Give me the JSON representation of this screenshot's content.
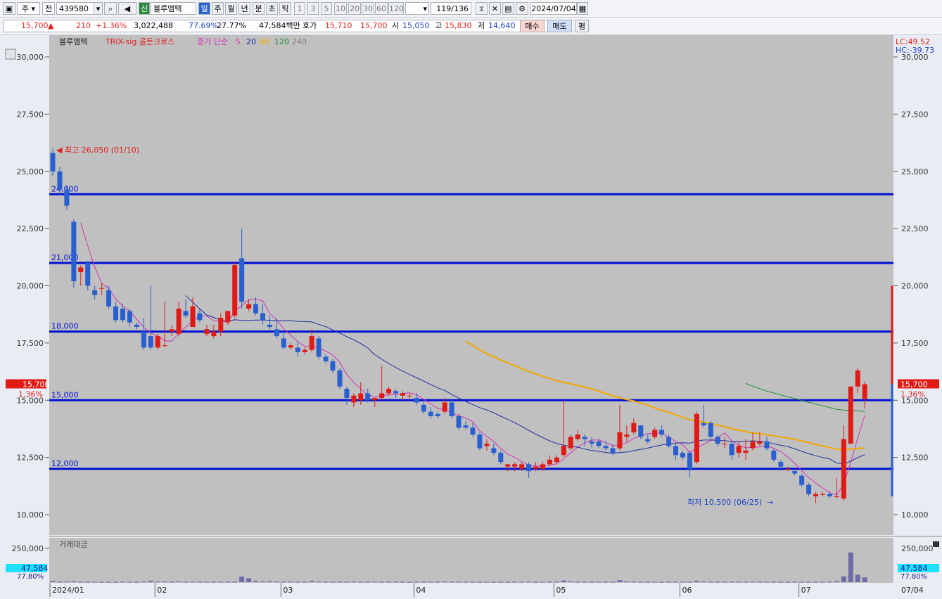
{
  "toolbar": {
    "market": "주",
    "price_type": "전",
    "code": "439580",
    "stock_badge": "신",
    "stock_name": "블루엠텍",
    "periods": [
      "일",
      "주",
      "월",
      "년",
      "분",
      "초",
      "틱"
    ],
    "minutes": [
      "1",
      "3",
      "5",
      "10",
      "20",
      "30",
      "60",
      "120"
    ],
    "count": "119",
    "count_total": "/136",
    "date": "2024/07/04"
  },
  "quote": {
    "price": "15,700",
    "change": "210",
    "change_pct": "+1.36%",
    "volume": "3,022,488",
    "ratio1": "77.69%",
    "ratio2": "27.77%",
    "amount": "47,584백만",
    "ask_label": "호가",
    "ask1": "15,710",
    "ask2": "15,700",
    "open_label": "시",
    "open": "15,050",
    "high_label": "고",
    "high": "15,830",
    "low_label": "저",
    "low": "14,640",
    "buy": "매수",
    "sell": "매도",
    "eval": "평"
  },
  "chart_data": {
    "type": "candlestick",
    "legend": {
      "name": "블루엠텍",
      "indicator": "TRIX-sig 골든크로스",
      "ma_label": "종가 단순",
      "ma_periods": [
        "5",
        "20",
        "60",
        "120",
        "240"
      ],
      "colors": {
        "5": "#d233b8",
        "20": "#1f2f9e",
        "60": "#f2a900",
        "120": "#1c8a2e",
        "240": "#808080"
      }
    },
    "y_ticks": [
      "30,000",
      "27,500",
      "25,000",
      "22,500",
      "20,000",
      "17,500",
      "15,000",
      "12,500",
      "10,000"
    ],
    "ylim": [
      9500,
      30800
    ],
    "x_labels": [
      "2024/01",
      "02",
      "03",
      "04",
      "05",
      "06",
      "07"
    ],
    "hlines": [
      {
        "label": "24,000",
        "value": 24000
      },
      {
        "label": "21,000",
        "value": 21000
      },
      {
        "label": "18,000",
        "value": 18000
      },
      {
        "label": "15,000",
        "value": 15000
      },
      {
        "label": "12,000",
        "value": 12000
      }
    ],
    "max_note": "최고 26,050 (01/10)",
    "min_note": "최저 10,500 (06/25)",
    "last_price": "15,700",
    "last_pct": "1.36%",
    "right_info": {
      "lc": "LC:49.52",
      "hc": "HC:-39.73"
    },
    "volume_title": "거래대금",
    "volume_tick": "250,000",
    "volume_last": "47,584",
    "volume_pct": "77.80%",
    "end_date": "07/04",
    "candles": [
      [
        25800,
        26000,
        24800,
        25000
      ],
      [
        25000,
        25200,
        24000,
        24200
      ],
      [
        24200,
        24400,
        23300,
        23500
      ],
      [
        22800,
        22900,
        19900,
        20200
      ],
      [
        20600,
        20900,
        20000,
        20800
      ],
      [
        21000,
        21100,
        19800,
        20000
      ],
      [
        19800,
        20000,
        19400,
        19600
      ],
      [
        19900,
        20100,
        19600,
        19900
      ],
      [
        19800,
        20000,
        19000,
        19100
      ],
      [
        19100,
        19300,
        18400,
        18500
      ],
      [
        19000,
        19200,
        18400,
        18500
      ],
      [
        18900,
        19000,
        18200,
        18400
      ],
      [
        18300,
        18400,
        18100,
        18200
      ],
      [
        18000,
        18600,
        17200,
        17300
      ],
      [
        17800,
        20000,
        17200,
        17300
      ],
      [
        17300,
        17900,
        17200,
        17800
      ],
      [
        17400,
        19300,
        17300,
        17400
      ],
      [
        18000,
        18300,
        17800,
        18100
      ],
      [
        17900,
        19300,
        17800,
        19000
      ],
      [
        18900,
        19400,
        18600,
        18700
      ],
      [
        18200,
        19500,
        18200,
        19100
      ],
      [
        18800,
        19000,
        18400,
        18500
      ],
      [
        17900,
        18300,
        17800,
        18100
      ],
      [
        17800,
        18300,
        17700,
        18000
      ],
      [
        18000,
        18800,
        17800,
        18600
      ],
      [
        18400,
        18900,
        18300,
        18900
      ],
      [
        18700,
        21000,
        18600,
        20900
      ],
      [
        21200,
        22500,
        19000,
        19300
      ],
      [
        19000,
        19400,
        18900,
        19200
      ],
      [
        19200,
        19500,
        18700,
        18800
      ],
      [
        18800,
        19200,
        18300,
        18500
      ],
      [
        18300,
        18700,
        18100,
        18200
      ],
      [
        18100,
        18600,
        17700,
        17800
      ],
      [
        17700,
        18000,
        17200,
        17300
      ],
      [
        17300,
        17500,
        17200,
        17400
      ],
      [
        17300,
        17600,
        16900,
        17100
      ],
      [
        17100,
        17300,
        17000,
        17200
      ],
      [
        17200,
        18100,
        17100,
        17800
      ],
      [
        17700,
        17800,
        16800,
        16900
      ],
      [
        16900,
        17000,
        16600,
        16700
      ],
      [
        16700,
        16800,
        16200,
        16300
      ],
      [
        16300,
        16400,
        15500,
        15600
      ],
      [
        15500,
        15600,
        14800,
        15100
      ],
      [
        14900,
        15300,
        14700,
        15200
      ],
      [
        15000,
        15800,
        14800,
        15300
      ],
      [
        15300,
        15500,
        14900,
        15000
      ],
      [
        15000,
        15100,
        14700,
        15100
      ],
      [
        15100,
        16500,
        15000,
        15300
      ],
      [
        15300,
        15600,
        15200,
        15500
      ],
      [
        15400,
        15500,
        15100,
        15300
      ],
      [
        15200,
        15400,
        15000,
        15300
      ],
      [
        15200,
        15300,
        15100,
        15200
      ],
      [
        15100,
        15300,
        14800,
        14900
      ],
      [
        14800,
        15000,
        14400,
        14500
      ],
      [
        14500,
        14700,
        14200,
        14300
      ],
      [
        14400,
        14500,
        14200,
        14300
      ],
      [
        14500,
        15100,
        14400,
        14900
      ],
      [
        14900,
        15000,
        14200,
        14300
      ],
      [
        14300,
        14400,
        13700,
        13800
      ],
      [
        13900,
        14100,
        13700,
        13800
      ],
      [
        13800,
        14000,
        13400,
        13500
      ],
      [
        13500,
        13600,
        12800,
        12900
      ],
      [
        13000,
        13300,
        12800,
        13100
      ],
      [
        12900,
        13100,
        12600,
        12700
      ],
      [
        12700,
        12800,
        12200,
        12300
      ],
      [
        12100,
        12200,
        11900,
        12200
      ],
      [
        12100,
        12300,
        11900,
        12200
      ],
      [
        12000,
        12300,
        11900,
        12200
      ],
      [
        12200,
        12300,
        11600,
        11900
      ],
      [
        12000,
        12300,
        11900,
        12100
      ],
      [
        12000,
        12300,
        11900,
        12200
      ],
      [
        12200,
        12600,
        12100,
        12400
      ],
      [
        12300,
        12600,
        12200,
        12500
      ],
      [
        12600,
        15000,
        12500,
        13000
      ],
      [
        12900,
        13500,
        12800,
        13400
      ],
      [
        13300,
        13700,
        13200,
        13500
      ],
      [
        13400,
        13500,
        13000,
        13300
      ],
      [
        13200,
        13400,
        12900,
        13100
      ],
      [
        13200,
        13300,
        12900,
        13000
      ],
      [
        13000,
        13200,
        12800,
        12900
      ],
      [
        12900,
        13100,
        12600,
        12700
      ],
      [
        12900,
        14800,
        12800,
        13600
      ],
      [
        13400,
        13900,
        13200,
        13500
      ],
      [
        13600,
        14200,
        13500,
        14000
      ],
      [
        13900,
        13900,
        13300,
        13400
      ],
      [
        13300,
        13500,
        13100,
        13200
      ],
      [
        13400,
        13800,
        13300,
        13700
      ],
      [
        13700,
        13900,
        13400,
        13500
      ],
      [
        13400,
        13500,
        12900,
        13000
      ],
      [
        13000,
        13100,
        12400,
        12600
      ],
      [
        12700,
        12800,
        12400,
        12500
      ],
      [
        12700,
        12800,
        11600,
        12000
      ],
      [
        12300,
        14500,
        12200,
        14400
      ],
      [
        14000,
        14800,
        13800,
        13900
      ],
      [
        14000,
        14100,
        13300,
        13400
      ],
      [
        13400,
        13500,
        13000,
        13100
      ],
      [
        13100,
        13400,
        12900,
        13100
      ],
      [
        13100,
        13200,
        12400,
        12600
      ],
      [
        12700,
        13200,
        12500,
        13000
      ],
      [
        12700,
        13300,
        12400,
        12800
      ],
      [
        12900,
        13600,
        12800,
        13200
      ],
      [
        13100,
        13600,
        13000,
        13200
      ],
      [
        13200,
        13400,
        12800,
        12900
      ],
      [
        12800,
        12900,
        12300,
        12400
      ],
      [
        12300,
        12400,
        12000,
        12100
      ],
      [
        12000,
        12100,
        11900,
        12000
      ],
      [
        11900,
        12000,
        11700,
        11800
      ],
      [
        11700,
        11800,
        11200,
        11300
      ],
      [
        11300,
        11400,
        10800,
        10900
      ],
      [
        10800,
        11000,
        10500,
        10900
      ],
      [
        10900,
        11000,
        10800,
        10900
      ],
      [
        10900,
        11000,
        10700,
        10800
      ],
      [
        10800,
        11600,
        10700,
        10800
      ],
      [
        10700,
        13900,
        10600,
        13300
      ],
      [
        13100,
        14500,
        13100,
        15600
      ],
      [
        15600,
        16400,
        15300,
        16300
      ],
      [
        15050,
        15830,
        14640,
        15700
      ]
    ],
    "volumes": [
      8,
      3,
      4,
      6,
      3,
      3,
      3,
      2,
      2,
      2,
      3,
      3,
      2,
      4,
      10,
      4,
      4,
      3,
      5,
      3,
      4,
      3,
      3,
      3,
      3,
      3,
      3,
      40,
      28,
      9,
      5,
      6,
      4,
      3,
      4,
      3,
      3,
      9,
      4,
      3,
      3,
      3,
      3,
      4,
      3,
      3,
      4,
      3,
      3,
      3,
      3,
      2,
      3,
      3,
      3,
      3,
      4,
      3,
      3,
      3,
      3,
      2,
      3,
      2,
      2,
      2,
      3,
      3,
      4,
      2,
      3,
      3,
      3,
      12,
      5,
      3,
      3,
      3,
      3,
      3,
      3,
      14,
      5,
      4,
      3,
      3,
      3,
      2,
      3,
      3,
      3,
      3,
      10,
      4,
      3,
      3,
      3,
      3,
      3,
      3,
      4,
      3,
      3,
      3,
      2,
      2,
      3,
      3,
      2,
      3,
      3,
      4,
      8,
      42,
      220,
      55,
      35
    ]
  }
}
